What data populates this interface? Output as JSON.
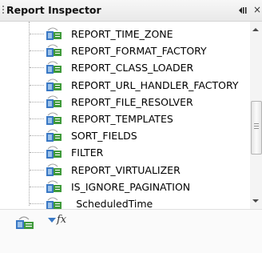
{
  "panel": {
    "title": "Report Inspector",
    "menu_icon": "view-menu-icon",
    "close_icon": "close-icon",
    "close_label": "×"
  },
  "tree": {
    "item_icon": "parameter-icon",
    "items": [
      {
        "label": "REPORT_TIME_ZONE"
      },
      {
        "label": "REPORT_FORMAT_FACTORY"
      },
      {
        "label": "REPORT_CLASS_LOADER"
      },
      {
        "label": "REPORT_URL_HANDLER_FACTORY"
      },
      {
        "label": "REPORT_FILE_RESOLVER"
      },
      {
        "label": "REPORT_TEMPLATES"
      },
      {
        "label": "SORT_FIELDS"
      },
      {
        "label": "FILTER"
      },
      {
        "label": "REPORT_VIRTUALIZER"
      },
      {
        "label": "IS_IGNORE_PAGINATION"
      },
      {
        "label": "_ScheduledTime"
      }
    ]
  },
  "toolbar": {
    "buttons": [
      {
        "icon": "add-parameter-icon"
      },
      {
        "icon": "expression-fx-icon",
        "label": "fx"
      }
    ]
  },
  "colors": {
    "icon_blue": "#3a78c4",
    "icon_green": "#3f9a3a",
    "icon_light_blue": "#9cc2ea"
  }
}
